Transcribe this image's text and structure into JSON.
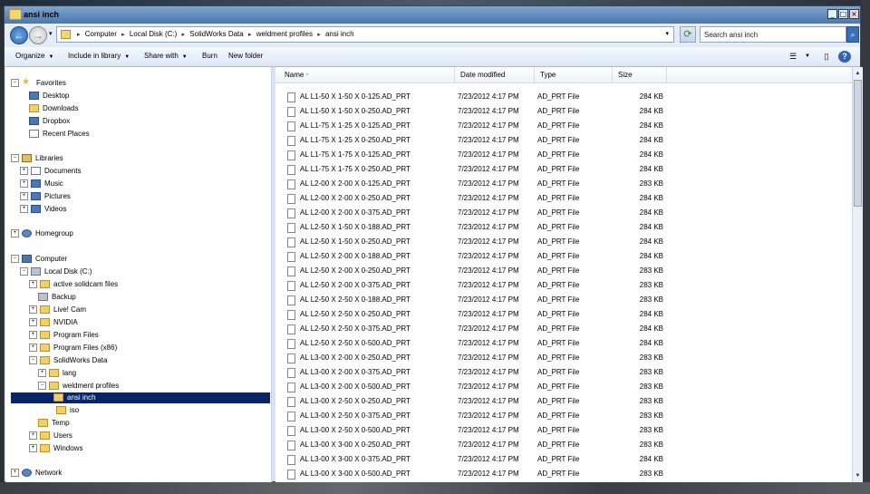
{
  "window": {
    "title": "ansi inch"
  },
  "address": {
    "crumbs": [
      "Computer",
      "Local Disk (C:)",
      "SolidWorks Data",
      "weldment profiles",
      "ansi inch"
    ],
    "separator": "▸",
    "dropdown": "▾"
  },
  "search": {
    "placeholder": "Search ansi inch"
  },
  "toolbar": {
    "organize": "Organize",
    "include_in_library": "Include in library",
    "share_with": "Share with",
    "burn": "Burn",
    "new_folder": "New folder"
  },
  "nav": {
    "favorites": "Favorites",
    "desktop": "Desktop",
    "downloads": "Downloads",
    "dropbox": "Dropbox",
    "recent_places": "Recent Places",
    "libraries": "Libraries",
    "documents": "Documents",
    "music": "Music",
    "pictures": "Pictures",
    "videos": "Videos",
    "homegroup": "Homegroup",
    "computer": "Computer",
    "local_disk": "Local Disk (C:)",
    "active_solidcam": "active solidcam files",
    "backup": "Backup",
    "live_cam": "Live! Cam",
    "nvidia": "NVIDIA",
    "program_files": "Program Files",
    "program_files_x86": "Program Files (x86)",
    "solidworks_data": "SolidWorks Data",
    "lang": "lang",
    "weldment_profiles": "weldment profiles",
    "ansi_inch": "ansi inch",
    "iso": "iso",
    "temp": "Temp",
    "users": "Users",
    "windows": "Windows",
    "network": "Network"
  },
  "columns": {
    "name": "Name",
    "date_modified": "Date modified",
    "type": "Type",
    "size": "Size"
  },
  "files": [
    {
      "name": "AL  L1-50 X 1-50 X 0-125.AD_PRT",
      "date": "7/23/2012 4:17 PM",
      "type": "AD_PRT File",
      "size": "284 KB"
    },
    {
      "name": "AL  L1-50 X 1-50 X 0-250.AD_PRT",
      "date": "7/23/2012 4:17 PM",
      "type": "AD_PRT File",
      "size": "284 KB"
    },
    {
      "name": "AL  L1-75 X 1-25 X 0-125.AD_PRT",
      "date": "7/23/2012 4:17 PM",
      "type": "AD_PRT File",
      "size": "284 KB"
    },
    {
      "name": "AL  L1-75 X 1-25 X 0-250.AD_PRT",
      "date": "7/23/2012 4:17 PM",
      "type": "AD_PRT File",
      "size": "284 KB"
    },
    {
      "name": "AL  L1-75 X 1-75 X 0-125.AD_PRT",
      "date": "7/23/2012 4:17 PM",
      "type": "AD_PRT File",
      "size": "284 KB"
    },
    {
      "name": "AL  L1-75 X 1-75 X 0-250.AD_PRT",
      "date": "7/23/2012 4:17 PM",
      "type": "AD_PRT File",
      "size": "284 KB"
    },
    {
      "name": "AL  L2-00 X 2-00 X 0-125.AD_PRT",
      "date": "7/23/2012 4:17 PM",
      "type": "AD_PRT File",
      "size": "283 KB"
    },
    {
      "name": "AL  L2-00 X 2-00 X 0-250.AD_PRT",
      "date": "7/23/2012 4:17 PM",
      "type": "AD_PRT File",
      "size": "284 KB"
    },
    {
      "name": "AL  L2-00 X 2-00 X 0-375.AD_PRT",
      "date": "7/23/2012 4:17 PM",
      "type": "AD_PRT File",
      "size": "284 KB"
    },
    {
      "name": "AL  L2-50 X 1-50 X 0-188.AD_PRT",
      "date": "7/23/2012 4:17 PM",
      "type": "AD_PRT File",
      "size": "284 KB"
    },
    {
      "name": "AL  L2-50 X 1-50 X 0-250.AD_PRT",
      "date": "7/23/2012 4:17 PM",
      "type": "AD_PRT File",
      "size": "284 KB"
    },
    {
      "name": "AL  L2-50 X 2-00 X 0-188.AD_PRT",
      "date": "7/23/2012 4:17 PM",
      "type": "AD_PRT File",
      "size": "284 KB"
    },
    {
      "name": "AL  L2-50 X 2-00 X 0-250.AD_PRT",
      "date": "7/23/2012 4:17 PM",
      "type": "AD_PRT File",
      "size": "283 KB"
    },
    {
      "name": "AL  L2-50 X 2-00 X 0-375.AD_PRT",
      "date": "7/23/2012 4:17 PM",
      "type": "AD_PRT File",
      "size": "283 KB"
    },
    {
      "name": "AL  L2-50 X 2-50 X 0-188.AD_PRT",
      "date": "7/23/2012 4:17 PM",
      "type": "AD_PRT File",
      "size": "283 KB"
    },
    {
      "name": "AL  L2-50 X 2-50 X 0-250.AD_PRT",
      "date": "7/23/2012 4:17 PM",
      "type": "AD_PRT File",
      "size": "284 KB"
    },
    {
      "name": "AL  L2-50 X 2-50 X 0-375.AD_PRT",
      "date": "7/23/2012 4:17 PM",
      "type": "AD_PRT File",
      "size": "284 KB"
    },
    {
      "name": "AL  L2-50 X 2-50 X 0-500.AD_PRT",
      "date": "7/23/2012 4:17 PM",
      "type": "AD_PRT File",
      "size": "284 KB"
    },
    {
      "name": "AL  L3-00 X 2-00 X 0-250.AD_PRT",
      "date": "7/23/2012 4:17 PM",
      "type": "AD_PRT File",
      "size": "283 KB"
    },
    {
      "name": "AL  L3-00 X 2-00 X 0-375.AD_PRT",
      "date": "7/23/2012 4:17 PM",
      "type": "AD_PRT File",
      "size": "283 KB"
    },
    {
      "name": "AL  L3-00 X 2-00 X 0-500.AD_PRT",
      "date": "7/23/2012 4:17 PM",
      "type": "AD_PRT File",
      "size": "283 KB"
    },
    {
      "name": "AL  L3-00 X 2-50 X 0-250.AD_PRT",
      "date": "7/23/2012 4:17 PM",
      "type": "AD_PRT File",
      "size": "283 KB"
    },
    {
      "name": "AL  L3-00 X 2-50 X 0-375.AD_PRT",
      "date": "7/23/2012 4:17 PM",
      "type": "AD_PRT File",
      "size": "283 KB"
    },
    {
      "name": "AL  L3-00 X 2-50 X 0-500.AD_PRT",
      "date": "7/23/2012 4:17 PM",
      "type": "AD_PRT File",
      "size": "283 KB"
    },
    {
      "name": "AL  L3-00 X 3-00 X 0-250.AD_PRT",
      "date": "7/23/2012 4:17 PM",
      "type": "AD_PRT File",
      "size": "283 KB"
    },
    {
      "name": "AL  L3-00 X 3-00 X 0-375.AD_PRT",
      "date": "7/23/2012 4:17 PM",
      "type": "AD_PRT File",
      "size": "284 KB"
    },
    {
      "name": "AL  L3-00 X 3-00 X 0-500.AD_PRT",
      "date": "7/23/2012 4:17 PM",
      "type": "AD_PRT File",
      "size": "283 KB"
    }
  ]
}
